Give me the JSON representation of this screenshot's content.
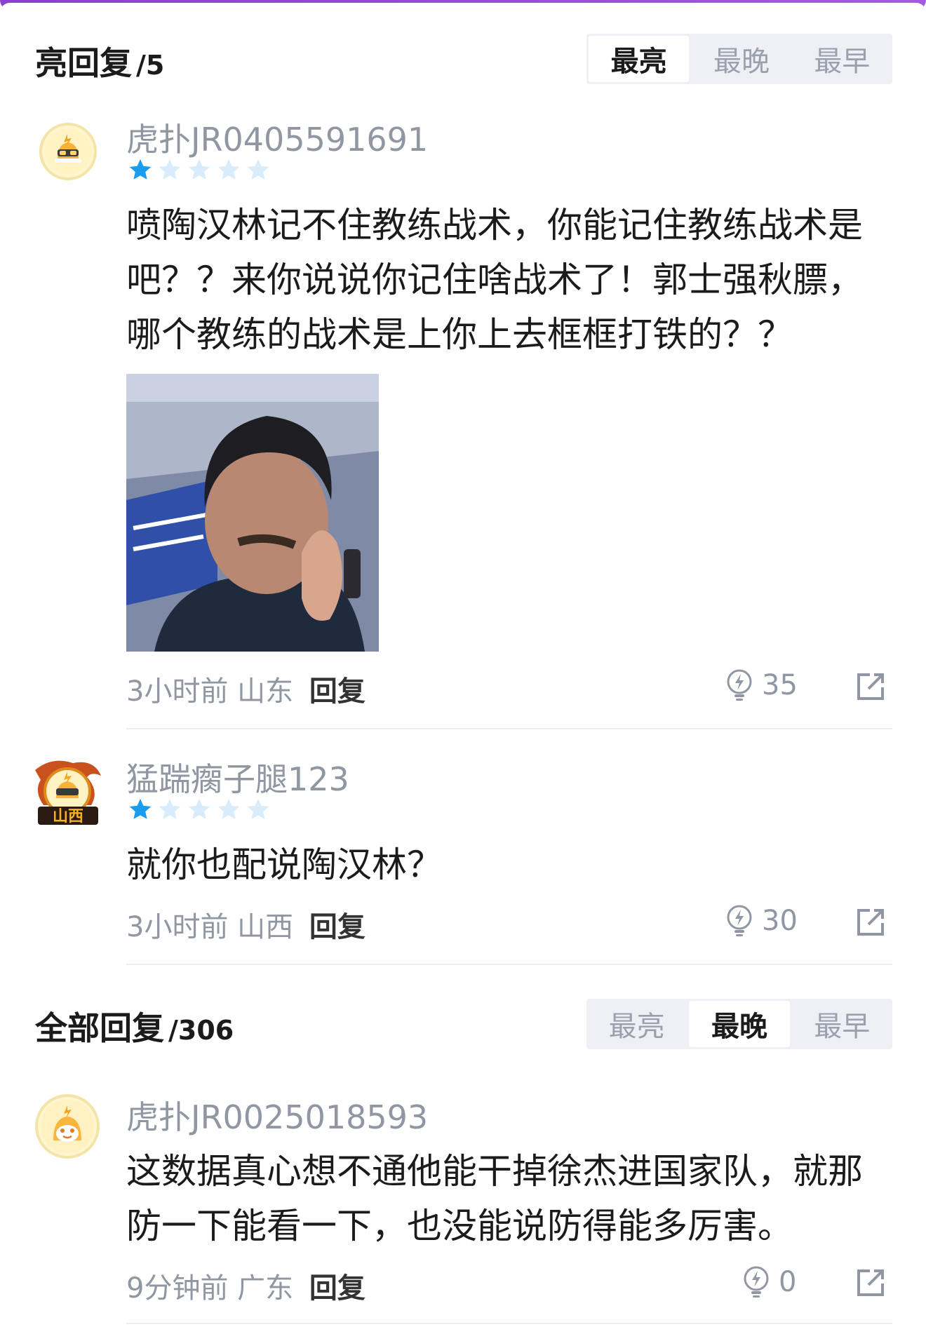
{
  "hot_section": {
    "title": "亮回复",
    "count": "/5",
    "sort_tabs": [
      "最亮",
      "最晚",
      "最早"
    ],
    "active_tab": "最亮"
  },
  "hot_comments": [
    {
      "username": "虎扑JR0405591691",
      "stars": 1,
      "text": "喷陶汉林记不住教练战术，你能记住教练战术是吧？？来你说说你记住啥战术了！郭士强秋膘，哪个教练的战术是上你上去框框打铁的？？",
      "has_image": true,
      "time": "3小时前",
      "location": "山东",
      "reply_label": "回复",
      "likes": "35"
    },
    {
      "username": "猛踹瘸子腿123",
      "stars": 1,
      "avatar_badge": "山西",
      "text": "就你也配说陶汉林？",
      "has_image": false,
      "time": "3小时前",
      "location": "山西",
      "reply_label": "回复",
      "likes": "30"
    }
  ],
  "all_section": {
    "title": "全部回复",
    "count": "/306",
    "sort_tabs": [
      "最亮",
      "最晚",
      "最早"
    ],
    "active_tab": "最晚"
  },
  "all_comments": [
    {
      "username": "虎扑JR0025018593",
      "text": "这数据真心想不通他能干掉徐杰进国家队，就那防一下能看一下，也没能说防得能多厉害。",
      "time": "9分钟前",
      "location": "广东",
      "reply_label": "回复",
      "likes": "0"
    }
  ],
  "colors": {
    "star_filled": "#1a9cf0",
    "star_empty": "#d9ecfb",
    "accent_purple": "#9447d6"
  }
}
